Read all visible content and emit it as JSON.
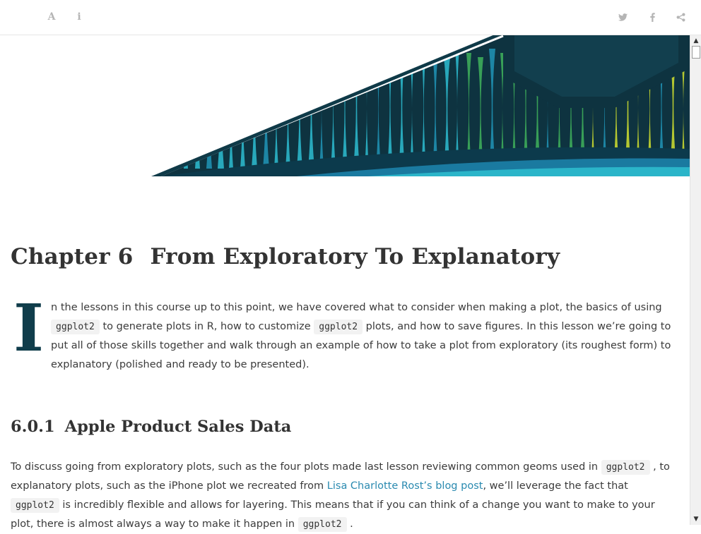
{
  "toolbar": {
    "left_icons": [
      "font-icon",
      "info-icon"
    ],
    "font_glyph": "A",
    "info_glyph": "i",
    "right_icons": [
      "twitter-icon",
      "facebook-icon",
      "share-icon"
    ]
  },
  "chapter": {
    "number": "Chapter 6",
    "title": "From Exploratory To Explanatory"
  },
  "intro": {
    "dropcap": "I",
    "seg1": "n the lessons in this course up to this point, we have covered what to consider when making a plot, the basics of using ",
    "code1": "ggplot2",
    "seg2": " to generate plots in R, how to customize ",
    "code2": "ggplot2",
    "seg3": " plots, and how to save figures. In this lesson we’re going to put all of those skills together and walk through an example of how to take a plot from exploratory (its roughest form) to explanatory (polished and ready to be presented)."
  },
  "section": {
    "number": "6.0.1",
    "title": "Apple Product Sales Data"
  },
  "body": {
    "seg1": "To discuss going from exploratory plots, such as the four plots made last lesson reviewing common geoms used in ",
    "code1": "ggplot2",
    "seg2": " , to explanatory plots, such as the iPhone plot we recreated from ",
    "link": "Lisa Charlotte Rost’s blog post",
    "seg3": ", we’ll leverage the fact that ",
    "code2": "ggplot2",
    "seg4": " is incredibly flexible and allows for layering. This means that if you can think of a change you want to make to your plot, there is almost always a way to make it happen in ",
    "code3": "ggplot2",
    "seg5": " ."
  },
  "colors": {
    "accent_dark": "#103d4b",
    "link": "#2a8ab0",
    "banner_teal": "#2bb5c9",
    "banner_green": "#3dab5a",
    "banner_yellow": "#c6d730"
  }
}
